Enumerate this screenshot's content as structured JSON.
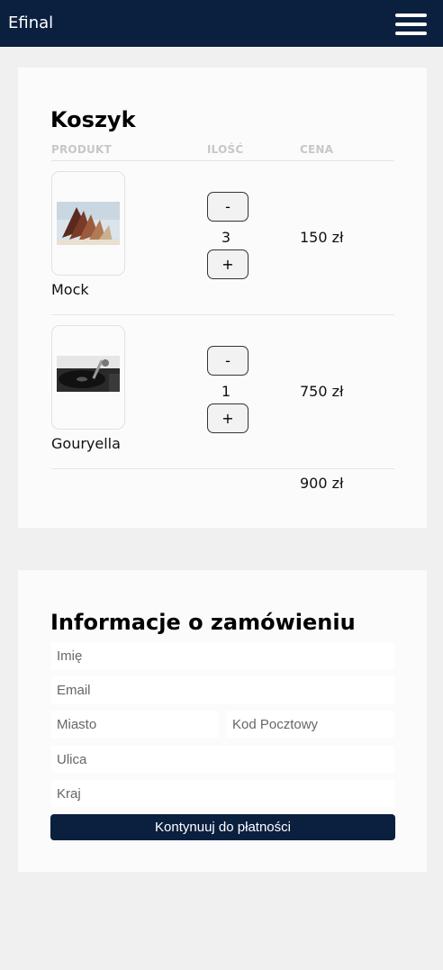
{
  "header": {
    "brand": "Efinal",
    "menu_icon": "hamburger-menu-icon",
    "background": "#0b1f3f"
  },
  "cart": {
    "title": "Koszyk",
    "columns": {
      "product": "PRODUKT",
      "quantity": "ILOŚĆ",
      "price": "CENA"
    },
    "items": [
      {
        "name": "Mock",
        "quantity": "3",
        "price": "150 zł",
        "decrement_label": "-",
        "increment_label": "+",
        "image_icon": "open-book-image"
      },
      {
        "name": "Gouryella",
        "quantity": "1",
        "price": "750 zł",
        "decrement_label": "-",
        "increment_label": "+",
        "image_icon": "turntable-image"
      }
    ],
    "total": "900 zł"
  },
  "order": {
    "title": "Informacje o zamówieniu",
    "fields": {
      "first_name": {
        "placeholder": "Imię",
        "value": ""
      },
      "email": {
        "placeholder": "Email",
        "value": ""
      },
      "city": {
        "placeholder": "Miasto",
        "value": ""
      },
      "postal_code": {
        "placeholder": "Kod Pocztowy",
        "value": ""
      },
      "street": {
        "placeholder": "Ulica",
        "value": ""
      },
      "country": {
        "placeholder": "Kraj",
        "value": ""
      }
    },
    "submit_label": "Kontynuuj do płatności"
  }
}
